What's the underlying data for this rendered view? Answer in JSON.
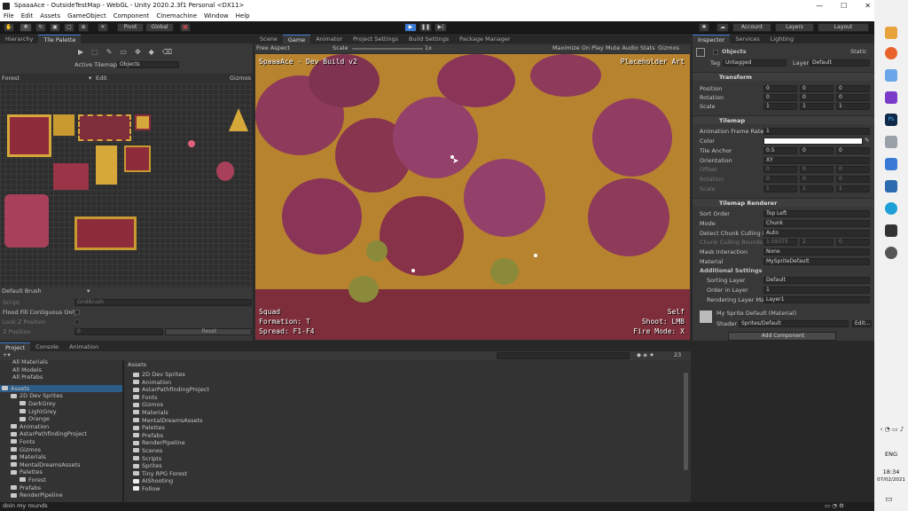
{
  "window": {
    "title": "SpaaaAce - OutsideTestMap - WebGL - Unity 2020.2.3f1 Personal <DX11>",
    "controls": [
      "—",
      "☐",
      "✕"
    ]
  },
  "menu": [
    "File",
    "Edit",
    "Assets",
    "GameObject",
    "Component",
    "Cinemachine",
    "Window",
    "Help"
  ],
  "toolbar": {
    "pivot": "Pivot",
    "global": "Global",
    "account": "Account",
    "layers": "Layers",
    "layout": "Layout"
  },
  "hierarchy": {
    "tabs": [
      "Hierarchy",
      "Tile Palette"
    ],
    "active_tilemap_label": "Active Tilemap",
    "active_tilemap_value": "Objects",
    "palette_name": "Forest",
    "edit_label": "Edit",
    "gizmos_label": "Gizmos",
    "brush_label": "Default Brush",
    "script_label": "Script",
    "script_value": "GridBrush",
    "flood_fill_label": "Flood Fill Contiguous Only",
    "lock_z_label": "Lock Z Position",
    "z_position_label": "Z Position",
    "z_position_value": "0",
    "reset_label": "Reset"
  },
  "scene_tabs": [
    "Scene",
    "Game",
    "Animator",
    "Project Settings",
    "Build Settings",
    "Package Manager"
  ],
  "game_toolbar": {
    "aspect": "Free Aspect",
    "scale_label": "Scale",
    "scale_value": "1x",
    "maximize": "Maximize On Play",
    "mute": "Mute Audio",
    "stats": "Stats",
    "gizmos": "Gizmos"
  },
  "game_hud": {
    "top_left": "SpaaaAce - Dev Build v2",
    "top_right": "Placeholder Art",
    "bottom_left": [
      "Squad",
      "Formation: T",
      "Spread: F1-F4"
    ],
    "bottom_right": [
      "Self",
      "Shoot: LMB",
      "Fire Mode: X"
    ]
  },
  "inspector": {
    "tabs": [
      "Inspector",
      "Services",
      "Lighting"
    ],
    "object_name": "Objects",
    "static_label": "Static",
    "tag_label": "Tag",
    "tag_value": "Untagged",
    "layer_label": "Layer",
    "layer_value": "Default",
    "transform": {
      "title": "Transform",
      "rows": [
        {
          "label": "Position",
          "x": "0",
          "y": "0",
          "z": "0"
        },
        {
          "label": "Rotation",
          "x": "0",
          "y": "0",
          "z": "0"
        },
        {
          "label": "Scale",
          "x": "1",
          "y": "1",
          "z": "1"
        }
      ]
    },
    "tilemap": {
      "title": "Tilemap",
      "anim_rate_label": "Animation Frame Rate",
      "anim_rate_value": "1",
      "color_label": "Color",
      "tile_anchor_label": "Tile Anchor",
      "anchor_x": "0.5",
      "anchor_y": "0",
      "anchor_z": "0",
      "orientation_label": "Orientation",
      "orientation_value": "XY",
      "offset_label": "Offset",
      "offset": [
        "0",
        "0",
        "0"
      ],
      "rotation_label": "Rotation",
      "rotation": [
        "0",
        "0",
        "0"
      ],
      "scale_label": "Scale",
      "scale": [
        "1",
        "1",
        "1"
      ]
    },
    "renderer": {
      "title": "Tilemap Renderer",
      "rows": [
        {
          "label": "Sort Order",
          "value": "Top Left"
        },
        {
          "label": "Mode",
          "value": "Chunk"
        },
        {
          "label": "Detect Chunk Culling Bo",
          "value": "Auto"
        }
      ],
      "culling_bounds_label": "Chunk Culling Bounds",
      "culling_x": "1.59375",
      "culling_y": "2",
      "culling_z": "0",
      "mask_label": "Mask Interaction",
      "mask_value": "None",
      "material_label": "Material",
      "material_value": "MySpriteDefault",
      "additional_label": "Additional Settings",
      "sorting_layer_label": "Sorting Layer",
      "sorting_layer_value": "Default",
      "order_label": "Order in Layer",
      "order_value": "1",
      "rendering_mask_label": "Rendering Layer Mas",
      "rendering_mask_value": "Layer1"
    },
    "material": {
      "name": "My Sprite Default (Material)",
      "shader_label": "Shader",
      "shader_value": "Sprites/Default",
      "edit_label": "Edit..."
    },
    "add_component": "Add Component"
  },
  "project": {
    "tabs": [
      "Project",
      "Console",
      "Animation"
    ],
    "favorites": [
      "All Materials",
      "All Models",
      "All Prefabs"
    ],
    "tree": [
      {
        "label": "Assets",
        "depth": 0
      },
      {
        "label": "2D Dev Sprites",
        "depth": 1
      },
      {
        "label": "DarkGrey",
        "depth": 2
      },
      {
        "label": "LightGrey",
        "depth": 2
      },
      {
        "label": "Orange",
        "depth": 2
      },
      {
        "label": "Animation",
        "depth": 1
      },
      {
        "label": "AstarPathfindingProject",
        "depth": 1
      },
      {
        "label": "Fonts",
        "depth": 1
      },
      {
        "label": "Gizmos",
        "depth": 1
      },
      {
        "label": "Materials",
        "depth": 1
      },
      {
        "label": "MentalDreamsAssets",
        "depth": 1
      },
      {
        "label": "Palettes",
        "depth": 1
      },
      {
        "label": "Forest",
        "depth": 2
      },
      {
        "label": "Prefabs",
        "depth": 1
      },
      {
        "label": "RenderPipeline",
        "depth": 1
      }
    ],
    "breadcrumb": "Assets",
    "count_label": "23",
    "assets": [
      "2D Dev Sprites",
      "Animation",
      "AstarPathfindingProject",
      "Fonts",
      "Gizmos",
      "Materials",
      "MentalDreamsAssets",
      "Palettes",
      "Prefabs",
      "RenderPipeline",
      "Scenes",
      "Scripts",
      "Sprites",
      "Tiny RPG Forest",
      "AIShooting",
      "Follow"
    ]
  },
  "status_bar": "doin my rounds",
  "taskbar": {
    "lang": "ENG",
    "time": "18:34",
    "date": "07/02/2021"
  },
  "colors": {
    "accent": "#3c7ad6",
    "ground": "#b8832f",
    "tree": "#8e3a5a",
    "path": "#7d2e3a"
  }
}
